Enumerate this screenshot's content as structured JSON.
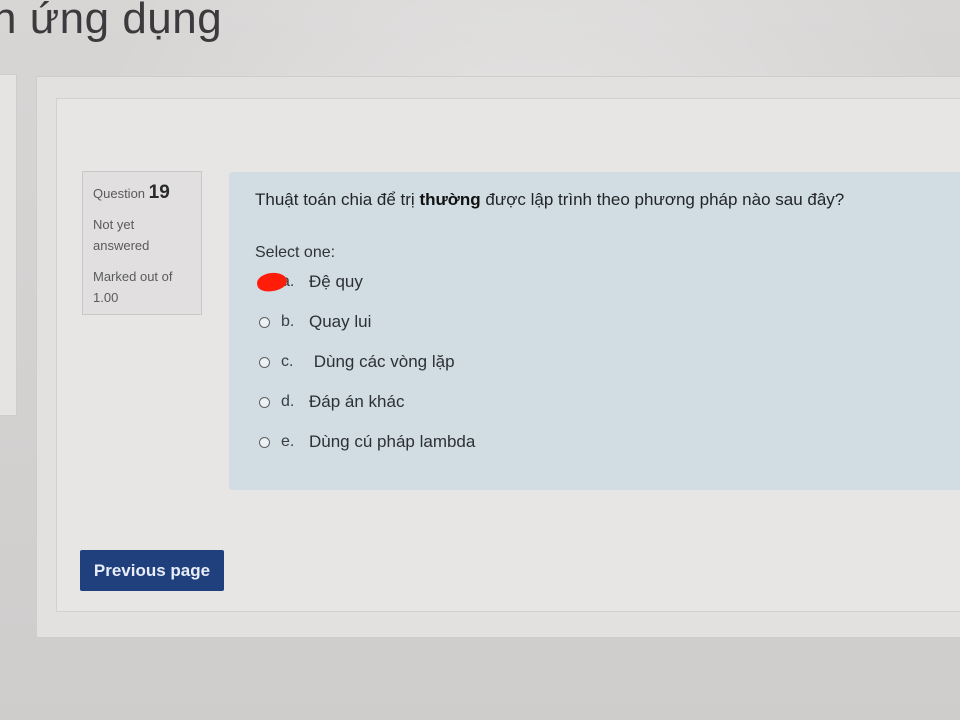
{
  "page": {
    "title": "n ứng dụng"
  },
  "question": {
    "label": "Question",
    "number": "19",
    "state": "Not yet answered",
    "grade": "Marked out of 1.00",
    "text_before": "Thuật toán chia để trị ",
    "text_bold": "thường",
    "text_after": " được lập trình theo phương pháp nào sau đây?",
    "prompt": "Select one:",
    "options": [
      {
        "letter": "a.",
        "text": "Đệ quy",
        "selected": true
      },
      {
        "letter": "b.",
        "text": "Quay lui",
        "selected": false
      },
      {
        "letter": "c.",
        "text": " Dùng các vòng lặp",
        "selected": false
      },
      {
        "letter": "d.",
        "text": "Đáp án khác",
        "selected": false
      },
      {
        "letter": "e.",
        "text": "Dùng cú pháp lambda",
        "selected": false
      }
    ]
  },
  "navigation": {
    "previous_label": "Previous page"
  },
  "colors": {
    "button_bg": "#1f3f7d",
    "question_bg": "#d1dde3",
    "selection_mark": "#ff1d0a"
  }
}
